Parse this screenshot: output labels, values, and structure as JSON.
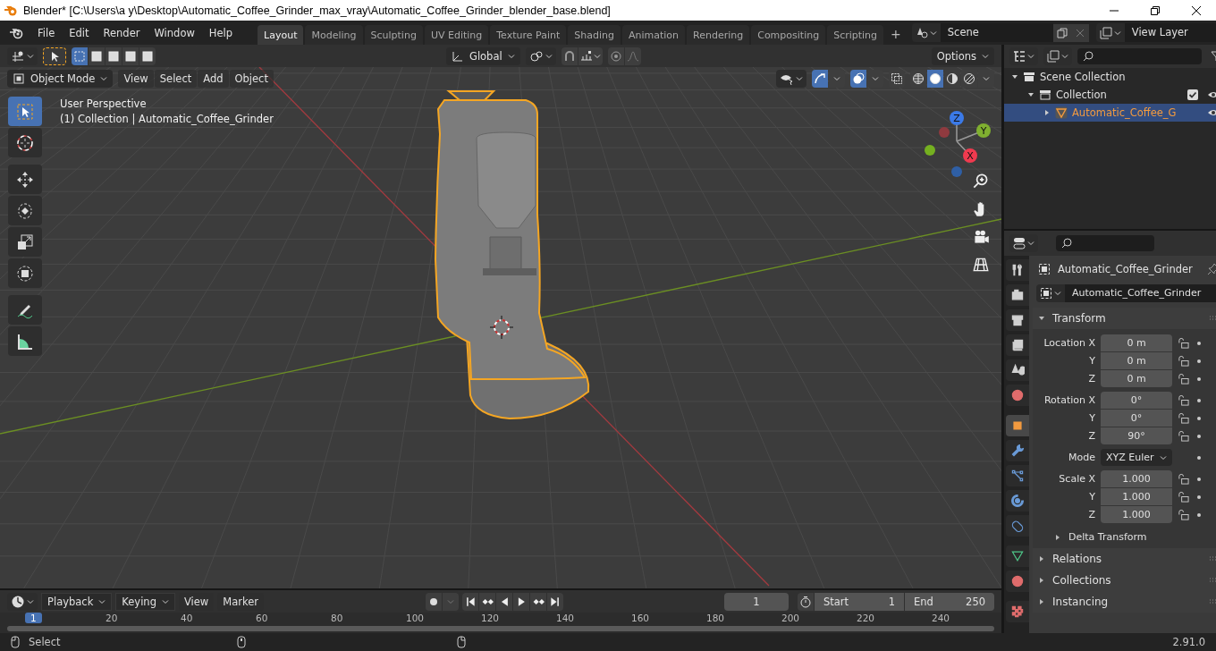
{
  "window": {
    "title": "Blender* [C:\\Users\\a y\\Desktop\\Automatic_Coffee_Grinder_max_vray\\Automatic_Coffee_Grinder_blender_base.blend]"
  },
  "menu": [
    "File",
    "Edit",
    "Render",
    "Window",
    "Help"
  ],
  "workspaces": [
    {
      "label": "Layout",
      "selected": true
    },
    {
      "label": "Modeling",
      "selected": false
    },
    {
      "label": "Sculpting",
      "selected": false
    },
    {
      "label": "UV Editing",
      "selected": false
    },
    {
      "label": "Texture Paint",
      "selected": false
    },
    {
      "label": "Shading",
      "selected": false
    },
    {
      "label": "Animation",
      "selected": false
    },
    {
      "label": "Rendering",
      "selected": false
    },
    {
      "label": "Compositing",
      "selected": false
    },
    {
      "label": "Scripting",
      "selected": false
    }
  ],
  "add_workspace": "+",
  "scene": {
    "value": "Scene"
  },
  "view_layer": {
    "value": "View Layer"
  },
  "tool_header": {
    "select_modes": [
      {
        "selected": true
      },
      {
        "selected": false
      },
      {
        "selected": false
      },
      {
        "selected": false
      },
      {
        "selected": false
      }
    ],
    "orientation": "Global",
    "snap": {
      "on": false
    },
    "proportional": {
      "on": false
    },
    "options": "Options"
  },
  "viewport_header": {
    "mode": "Object Mode",
    "menus": [
      "View",
      "Select",
      "Add",
      "Object"
    ],
    "toggles": [
      {
        "kind": "gizmos",
        "on": true
      },
      {
        "kind": "overlays",
        "on": true
      },
      {
        "kind": "xray",
        "on": false
      }
    ],
    "shading": [
      {
        "kind": "wireframe",
        "selected": false
      },
      {
        "kind": "solid",
        "selected": true
      },
      {
        "kind": "material",
        "selected": false
      },
      {
        "kind": "rendered",
        "selected": false
      }
    ]
  },
  "viewport": {
    "perspective": "User Perspective",
    "context": "(1) Collection | Automatic_Coffee_Grinder",
    "tools": [
      {
        "kind": "select",
        "selected": true
      },
      {
        "kind": "cursor",
        "selected": false
      },
      {
        "kind": "move",
        "selected": false
      },
      {
        "kind": "rotate",
        "selected": false
      },
      {
        "kind": "scale",
        "selected": false
      },
      {
        "kind": "transform",
        "selected": false
      },
      {
        "kind": "annotate",
        "selected": false
      },
      {
        "kind": "measure",
        "selected": false
      }
    ],
    "gizmo_axes": [
      "X",
      "Y",
      "Z"
    ]
  },
  "outliner": {
    "items": [
      {
        "kind": "scene_collection",
        "label": "Scene Collection",
        "selected": false,
        "expanded": true,
        "children": [
          {
            "kind": "collection",
            "label": "Collection",
            "selected": false,
            "expanded": true,
            "checked": true,
            "children": [
              {
                "kind": "object",
                "label": "Automatic_Coffee_G",
                "selected": true,
                "expanded": false
              }
            ]
          }
        ]
      }
    ]
  },
  "properties": {
    "tabs": [
      {
        "kind": "tool",
        "selected": false
      },
      {
        "kind": "render",
        "selected": false
      },
      {
        "kind": "output",
        "selected": false
      },
      {
        "kind": "view_layer",
        "selected": false
      },
      {
        "kind": "scene",
        "selected": false
      },
      {
        "kind": "world",
        "selected": false
      },
      {
        "kind": "object",
        "selected": true
      },
      {
        "kind": "modifiers",
        "selected": false
      },
      {
        "kind": "particles",
        "selected": false
      },
      {
        "kind": "physics",
        "selected": false
      },
      {
        "kind": "constraints",
        "selected": false
      },
      {
        "kind": "data",
        "selected": false
      },
      {
        "kind": "material",
        "selected": false
      },
      {
        "kind": "texture",
        "selected": false
      }
    ],
    "object_name": "Automatic_Coffee_Grinder",
    "datablock": "Automatic_Coffee_Grinder",
    "transform": {
      "label": "Transform",
      "expanded": true,
      "groups": [
        {
          "rows": [
            {
              "kind": "number",
              "label": "Location X",
              "value": "0 m"
            },
            {
              "kind": "number",
              "label": "Y",
              "value": "0 m"
            },
            {
              "kind": "number",
              "label": "Z",
              "value": "0 m"
            }
          ]
        },
        {
          "rows": [
            {
              "kind": "number",
              "label": "Rotation X",
              "value": "0°"
            },
            {
              "kind": "number",
              "label": "Y",
              "value": "0°"
            },
            {
              "kind": "number",
              "label": "Z",
              "value": "90°"
            }
          ]
        },
        {
          "rows": [
            {
              "kind": "dropdown",
              "label": "Mode",
              "value": "XYZ Euler"
            }
          ]
        },
        {
          "rows": [
            {
              "kind": "number",
              "label": "Scale X",
              "value": "1.000"
            },
            {
              "kind": "number",
              "label": "Y",
              "value": "1.000"
            },
            {
              "kind": "number",
              "label": "Z",
              "value": "1.000"
            }
          ]
        }
      ],
      "subpanels": [
        {
          "label": "Delta Transform",
          "expanded": false
        }
      ]
    },
    "panels": [
      {
        "label": "Relations",
        "expanded": false
      },
      {
        "label": "Collections",
        "expanded": false
      },
      {
        "label": "Instancing",
        "expanded": false
      }
    ]
  },
  "timeline": {
    "menus": [
      {
        "label": "Playback",
        "dropdown": true
      },
      {
        "label": "Keying",
        "dropdown": true
      },
      {
        "label": "View",
        "dropdown": false
      },
      {
        "label": "Marker",
        "dropdown": false
      }
    ],
    "current_frame": "1",
    "start_label": "Start",
    "start": "1",
    "end_label": "End",
    "end": "250",
    "ruler": [
      {
        "label": "1",
        "selected": true
      },
      {
        "label": "20",
        "selected": false
      },
      {
        "label": "40",
        "selected": false
      },
      {
        "label": "60",
        "selected": false
      },
      {
        "label": "80",
        "selected": false
      },
      {
        "label": "100",
        "selected": false
      },
      {
        "label": "120",
        "selected": false
      },
      {
        "label": "140",
        "selected": false
      },
      {
        "label": "160",
        "selected": false
      },
      {
        "label": "180",
        "selected": false
      },
      {
        "label": "200",
        "selected": false
      },
      {
        "label": "220",
        "selected": false
      },
      {
        "label": "240",
        "selected": false
      }
    ]
  },
  "status_bar": {
    "action": "Select",
    "version": "2.91.0"
  }
}
